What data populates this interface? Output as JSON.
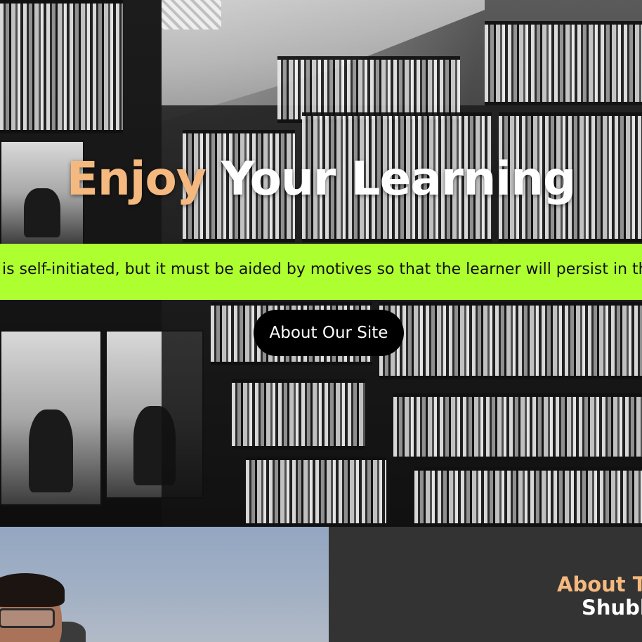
{
  "hero": {
    "title_accent": "Enjoy",
    "title_rest": " Your Learning",
    "background_image": "bookshelf-photo"
  },
  "marquee": {
    "text": "g is self-initiated, but it must be aided by motives so that the learner will persist in the learnin"
  },
  "cta": {
    "label": "About Our Site"
  },
  "about": {
    "heading": "About Th",
    "name": "Shubh",
    "photo": "person-photo"
  },
  "colors": {
    "accent": "#f5b97f",
    "marquee_bg": "#adff2f",
    "button_bg": "#000000",
    "about_bg": "#333333"
  }
}
